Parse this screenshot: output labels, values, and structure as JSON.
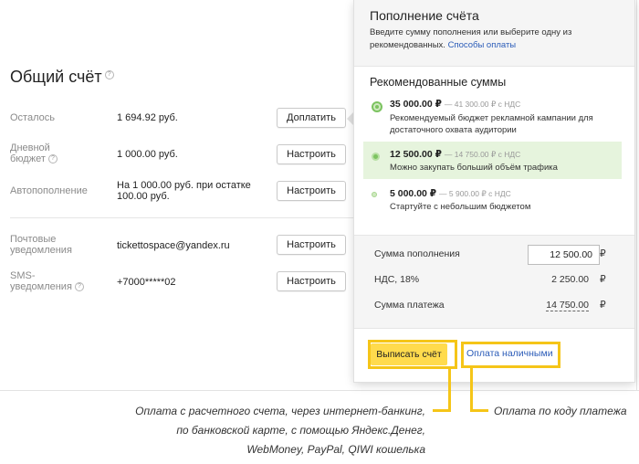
{
  "account": {
    "title": "Общий счёт",
    "help": "?"
  },
  "rows": [
    {
      "label": "Осталось",
      "value": "1 694.92 руб.",
      "button": "Доплатить"
    },
    {
      "label": "Дневной бюджет",
      "value": "1 000.00 руб.",
      "button": "Настроить"
    },
    {
      "label": "Автопополнение",
      "value": "На 1 000.00 руб. при остатке 100.00 руб.",
      "button": "Настроить"
    },
    {
      "label": "Почтовые уведомления",
      "value": "tickettospace@yandex.ru",
      "button": "Настроить"
    },
    {
      "label": "SMS-уведомления",
      "value": "+7000*****02",
      "button": "Настроить"
    }
  ],
  "labels_split": {
    "daily_1": "Дневной",
    "daily_2": "бюджет",
    "mail_1": "Почтовые",
    "mail_2": "уведомления",
    "sms_1": "SMS-",
    "sms_2": "уведомления",
    "auto_1": "На 1 000.00 руб. при остатке",
    "auto_2": "100.00 руб."
  },
  "popup": {
    "title": "Пополнение счёта",
    "desc_1": "Введите сумму пополнения или выберите одну из",
    "desc_2": "рекомендованных.",
    "desc_link": "Способы оплаты",
    "rec_title": "Рекомендованные суммы",
    "options": [
      {
        "amount": "35 000.00 ₽",
        "sub": "— 41 300.00 ₽ с НДС",
        "desc_1": "Рекомендуемый бюджет рекламной кампании для",
        "desc_2": "достаточного охвата аудитории",
        "selected": false
      },
      {
        "amount": "12 500.00 ₽",
        "sub": "— 14 750.00 ₽ с НДС",
        "desc_1": "Можно закупать больший объём трафика",
        "desc_2": "",
        "selected": true
      },
      {
        "amount": "5 000.00 ₽",
        "sub": "— 5 900.00 ₽ с НДС",
        "desc_1": "Стартуйте с небольшим бюджетом",
        "desc_2": "",
        "selected": false
      }
    ],
    "calc": {
      "sum_label": "Сумма пополнения",
      "sum_value": "12 500.00",
      "vat_label": "НДС, 18%",
      "vat_value": "2 250.00",
      "total_label": "Сумма платежа",
      "total_value": "14 750.00",
      "currency": "₽"
    },
    "invoice_button": "Выписать счёт",
    "cash_link": "Оплата наличными"
  },
  "captions": {
    "left_1": "Оплата с расчетного счета, через интернет-банкинг,",
    "left_2": "по банковской карте, с помощью Яндекс.Денег,",
    "left_3": "WebMoney, PayPal, QIWI кошелька",
    "right": "Оплата по коду платежа"
  },
  "colors": {
    "highlight": "#f5c518",
    "accent_yellow": "#ffdb4d",
    "link": "#2b5cb8",
    "selected_bg": "#e6f4dd",
    "radio_green": "#7cc360"
  }
}
